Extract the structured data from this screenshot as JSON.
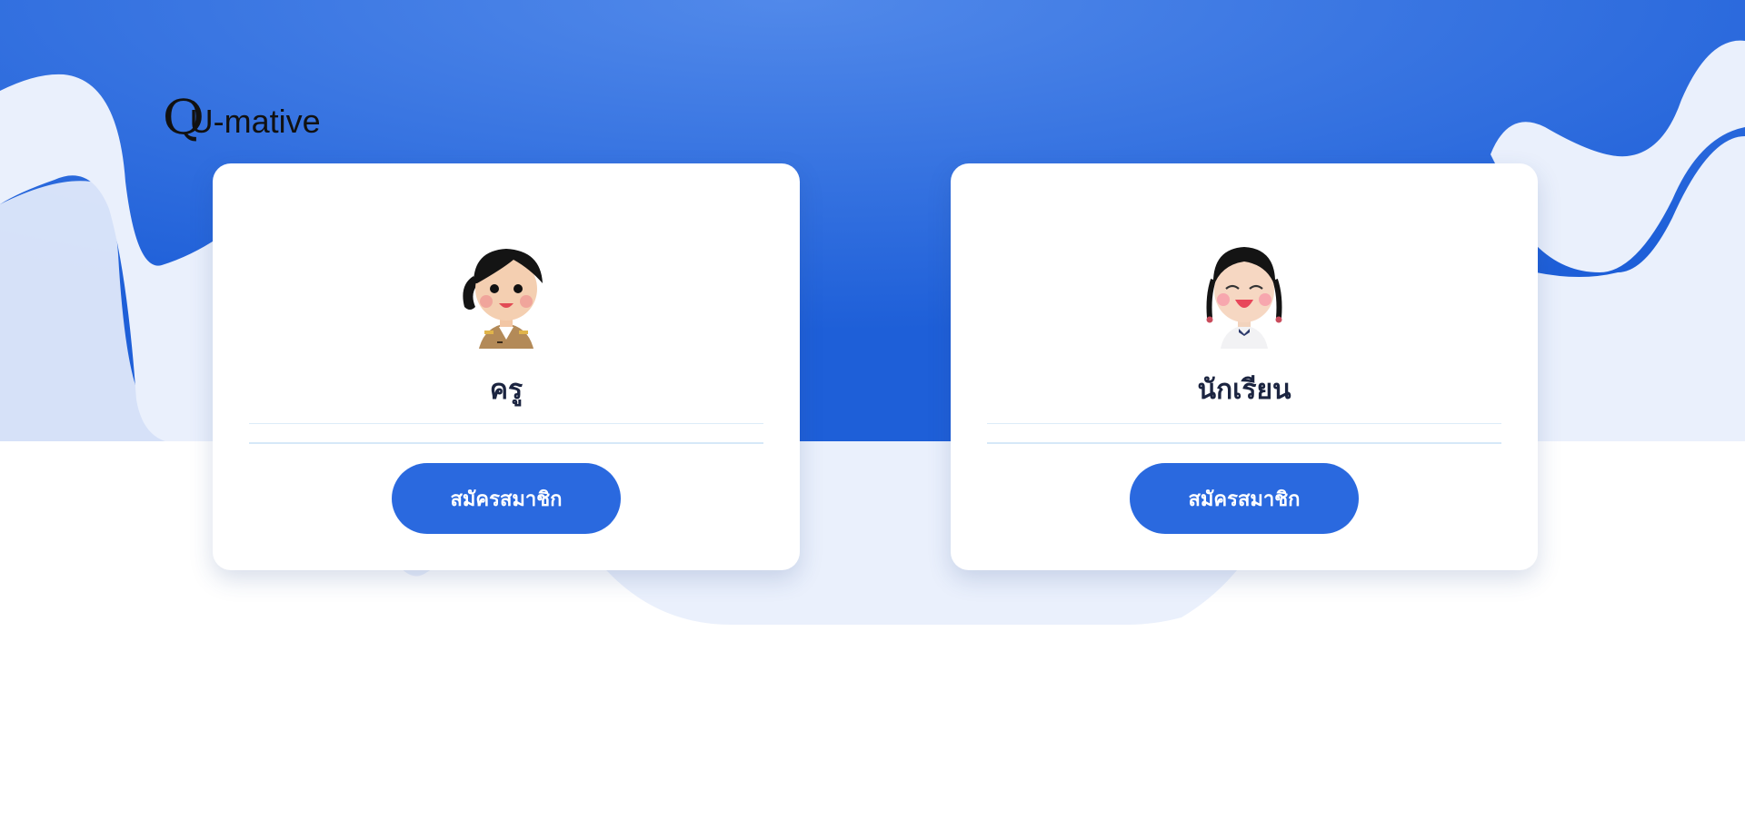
{
  "brand": {
    "logo_q": "Q",
    "logo_rest": "U-mative"
  },
  "colors": {
    "hero_blue": "#1f5fd9",
    "hero_light": "#4f88ea",
    "wave_light": "#eaf0fc",
    "button_blue": "#2a69df",
    "title_text": "#1b2440"
  },
  "cards": [
    {
      "role": "ครู",
      "avatar_icon": "teacher-avatar-icon",
      "button_label": "สมัครสมาชิก"
    },
    {
      "role": "นักเรียน",
      "avatar_icon": "student-avatar-icon",
      "button_label": "สมัครสมาชิก"
    }
  ]
}
